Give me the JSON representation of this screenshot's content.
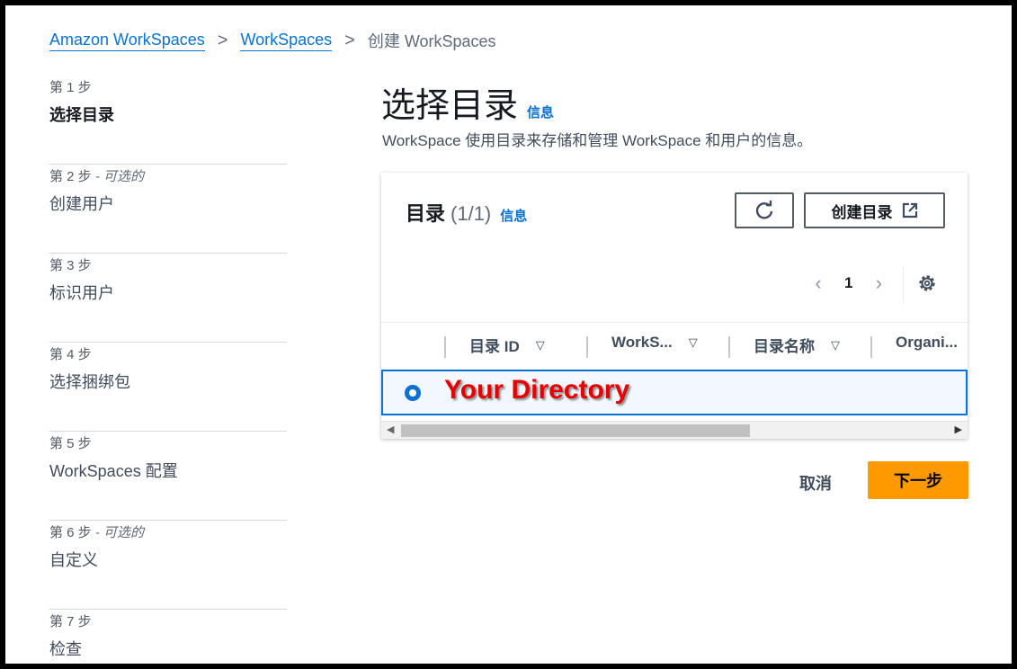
{
  "breadcrumb": {
    "items": [
      "Amazon WorkSpaces",
      "WorkSpaces"
    ],
    "current": "创建 WorkSpaces",
    "separator": ">"
  },
  "steps": [
    {
      "label": "第 1 步",
      "optional": "",
      "title": "选择目录",
      "active": true
    },
    {
      "label": "第 2 步",
      "optional": " - 可选的",
      "title": "创建用户",
      "active": false
    },
    {
      "label": "第 3 步",
      "optional": "",
      "title": "标识用户",
      "active": false
    },
    {
      "label": "第 4 步",
      "optional": "",
      "title": "选择捆绑包",
      "active": false
    },
    {
      "label": "第 5 步",
      "optional": "",
      "title": "WorkSpaces 配置",
      "active": false
    },
    {
      "label": "第 6 步",
      "optional": " - 可选的",
      "title": "自定义",
      "active": false
    },
    {
      "label": "第 7 步",
      "optional": "",
      "title": "检查",
      "active": false
    }
  ],
  "page": {
    "title": "选择目录",
    "info": "信息",
    "description": "WorkSpace 使用目录来存储和管理 WorkSpace 和用户的信息。"
  },
  "panel": {
    "title": "目录",
    "count": "(1/1)",
    "info": "信息",
    "refresh_icon": "refresh-icon",
    "create_label": "创建目录",
    "create_icon": "external-link-icon",
    "pager": {
      "prev": "‹",
      "page": "1",
      "next": "›"
    },
    "settings_icon": "gear-icon",
    "columns": [
      "目录 ID",
      "WorkS...",
      "目录名称",
      "Organi..."
    ],
    "row_label": "Your Directory",
    "row_selected": true
  },
  "actions": {
    "cancel": "取消",
    "next": "下一步"
  },
  "colors": {
    "link": "#0972d3",
    "primary_button": "#ff9900",
    "annotation": "#e60000"
  }
}
